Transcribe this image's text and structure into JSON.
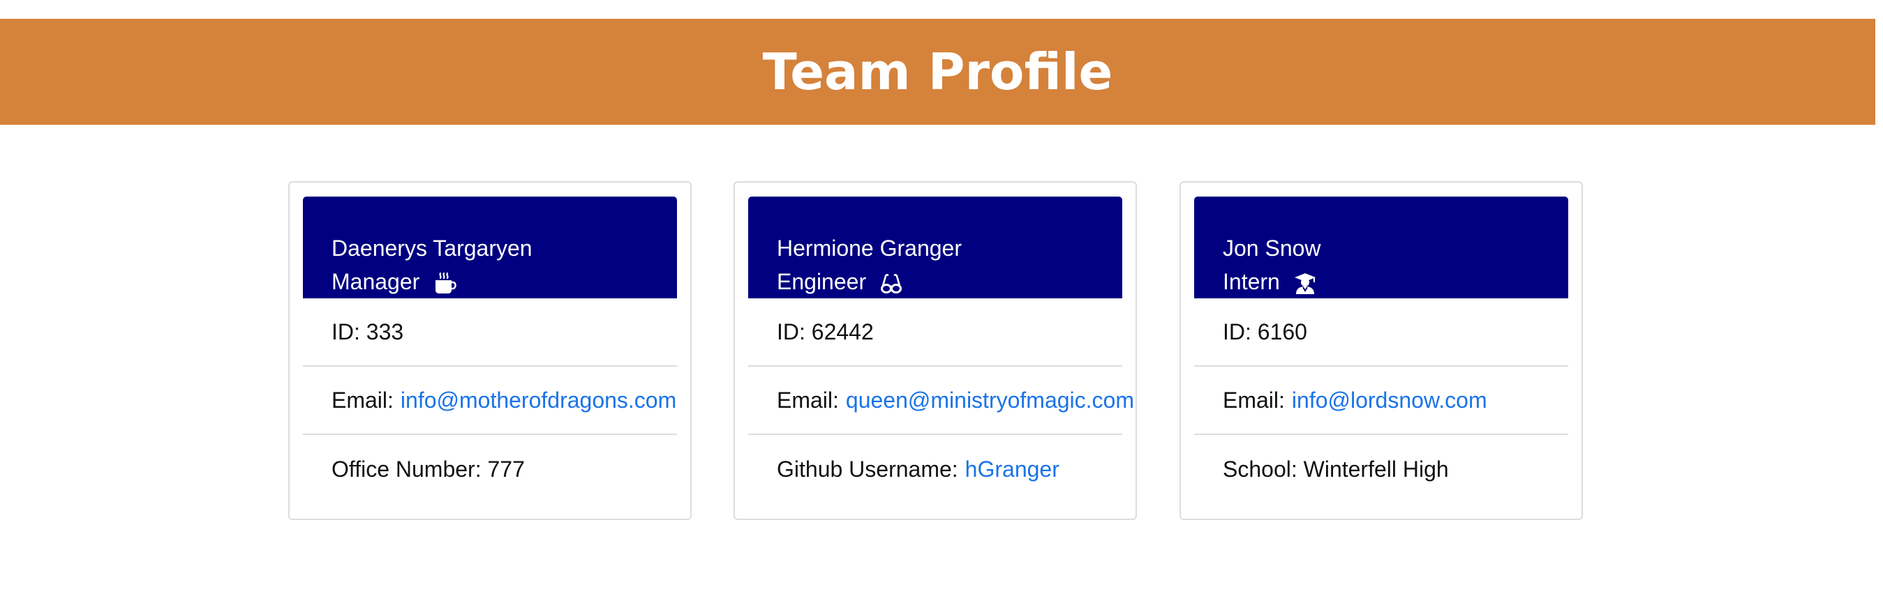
{
  "header": {
    "title": "Team Profile"
  },
  "colors": {
    "banner": "#d5823b",
    "card_header": "#000080",
    "link": "#1a73e8"
  },
  "employees": [
    {
      "name": "Daenerys Targaryen",
      "role": "Manager",
      "role_icon": "mug-hot-icon",
      "id_label": "ID: 333",
      "email_prefix": "Email:",
      "email": "info@motherofdragons.com",
      "extra_label": "Office Number: 777",
      "extra_link": ""
    },
    {
      "name": "Hermione Granger",
      "role": "Engineer",
      "role_icon": "glasses-icon",
      "id_label": "ID: 62442",
      "email_prefix": "Email:",
      "email": "queen@ministryofmagic.com",
      "extra_label": "Github Username:",
      "extra_link": "hGranger"
    },
    {
      "name": "Jon Snow",
      "role": "Intern",
      "role_icon": "graduate-icon",
      "id_label": "ID: 6160",
      "email_prefix": "Email:",
      "email": "info@lordsnow.com",
      "extra_label": "School: Winterfell High",
      "extra_link": ""
    }
  ]
}
